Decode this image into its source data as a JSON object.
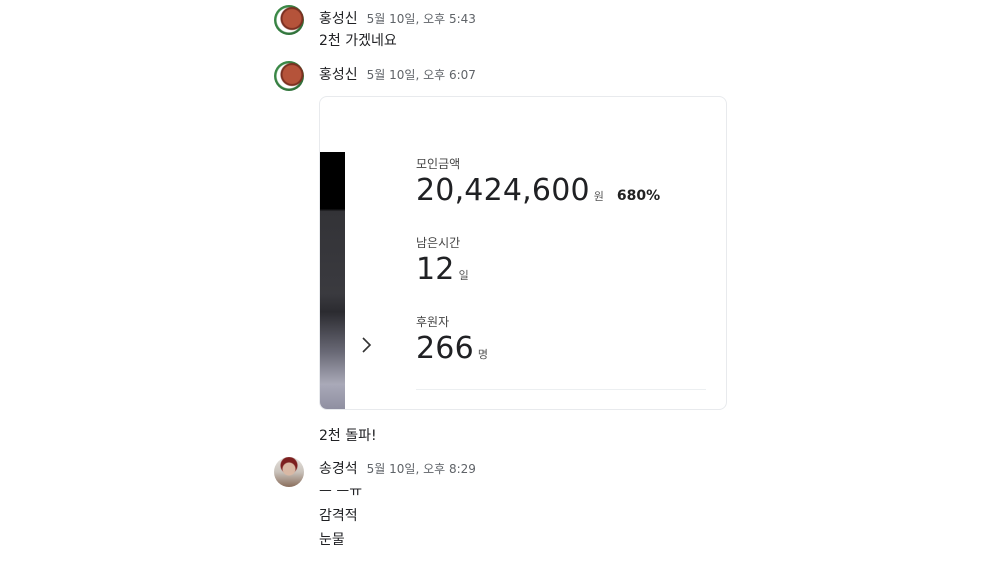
{
  "messages": [
    {
      "sender": "홍성신",
      "time": "5월 10일, 오후 5:43",
      "lines": [
        "2천 가겠네요"
      ]
    },
    {
      "sender": "홍성신",
      "time": "5월 10일, 오후 6:07",
      "card": {
        "raised_label": "모인금액",
        "raised_value": "20,424,600",
        "raised_unit": "원",
        "raised_percent": "680%",
        "remaining_label": "남은시간",
        "remaining_value": "12",
        "remaining_unit": "일",
        "backers_label": "후원자",
        "backers_value": "266",
        "backers_unit": "명"
      },
      "lines": [
        "2천 돌파!"
      ]
    },
    {
      "sender": "송경석",
      "time": "5월 10일, 오후 8:29",
      "lines": [
        "ㅡ ㅡㅠ",
        "감격적",
        "눈물"
      ]
    }
  ],
  "icons": {
    "avatar_1": "avatar-icon",
    "avatar_2": "avatar-icon",
    "avatar_3": "avatar-icon",
    "card_next": "chevron-right-icon"
  }
}
